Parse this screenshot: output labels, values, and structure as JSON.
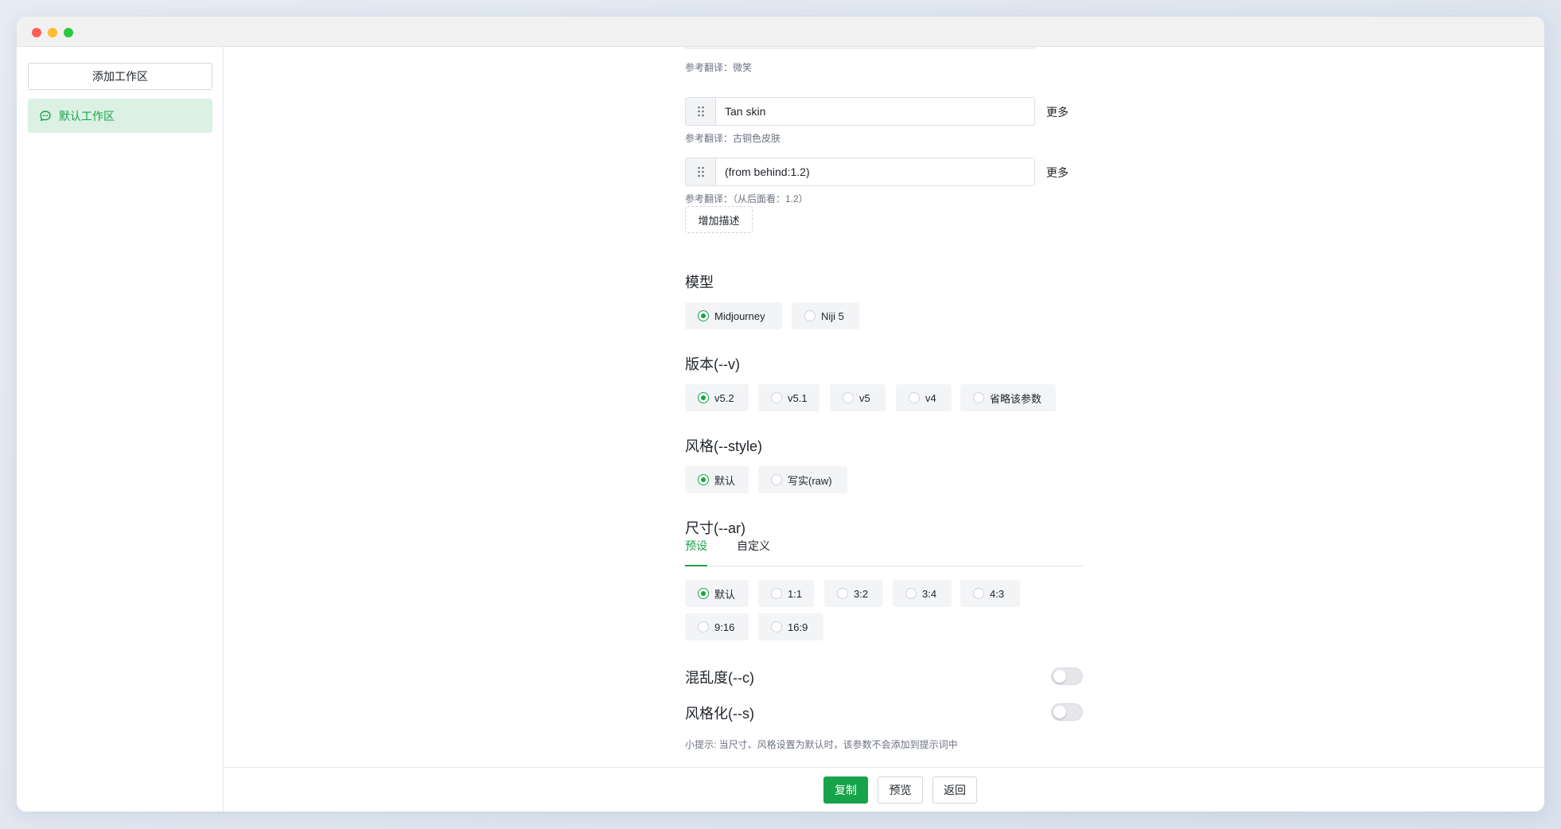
{
  "sidebar": {
    "add_workspace_label": "添加工作区",
    "workspaces": [
      {
        "label": "默认工作区",
        "icon": "chat-bubble-icon",
        "active": true
      }
    ]
  },
  "descriptions": {
    "first_hint": "参考翻译：微笑",
    "items": [
      {
        "value": "Tan skin",
        "more_label": "更多",
        "hint": "参考翻译：古铜色皮肤"
      },
      {
        "value": "(from behind:1.2)",
        "more_label": "更多",
        "hint": "参考翻译：（从后面看：1.2）"
      }
    ],
    "add_label": "增加描述"
  },
  "model": {
    "title": "模型",
    "options": [
      {
        "label": "Midjourney",
        "checked": true
      },
      {
        "label": "Niji 5",
        "checked": false
      }
    ]
  },
  "version": {
    "title": "版本(--v)",
    "options": [
      {
        "label": "v5.2",
        "checked": true
      },
      {
        "label": "v5.1",
        "checked": false
      },
      {
        "label": "v5",
        "checked": false
      },
      {
        "label": "v4",
        "checked": false
      },
      {
        "label": "省略该参数",
        "checked": false
      }
    ]
  },
  "style": {
    "title": "风格(--style)",
    "options": [
      {
        "label": "默认",
        "checked": true
      },
      {
        "label": "写实(raw)",
        "checked": false
      }
    ]
  },
  "size": {
    "title": "尺寸(--ar)",
    "tabs": [
      {
        "label": "预设",
        "active": true
      },
      {
        "label": "自定义",
        "active": false
      }
    ],
    "options": [
      {
        "label": "默认",
        "checked": true
      },
      {
        "label": "1:1",
        "checked": false
      },
      {
        "label": "3:2",
        "checked": false
      },
      {
        "label": "3:4",
        "checked": false
      },
      {
        "label": "4:3",
        "checked": false
      },
      {
        "label": "9:16",
        "checked": false
      },
      {
        "label": "16:9",
        "checked": false
      }
    ]
  },
  "chaos": {
    "title": "混乱度(--c)",
    "enabled": false
  },
  "stylize": {
    "title": "风格化(--s)",
    "enabled": false
  },
  "tip": "小提示: 当尺寸、风格设置为默认时，该参数不会添加到提示词中",
  "footer": {
    "copy_label": "复制",
    "preview_label": "预览",
    "back_label": "返回"
  },
  "colors": {
    "accent": "#17a34a",
    "accent_bg": "#dcf1e3"
  }
}
